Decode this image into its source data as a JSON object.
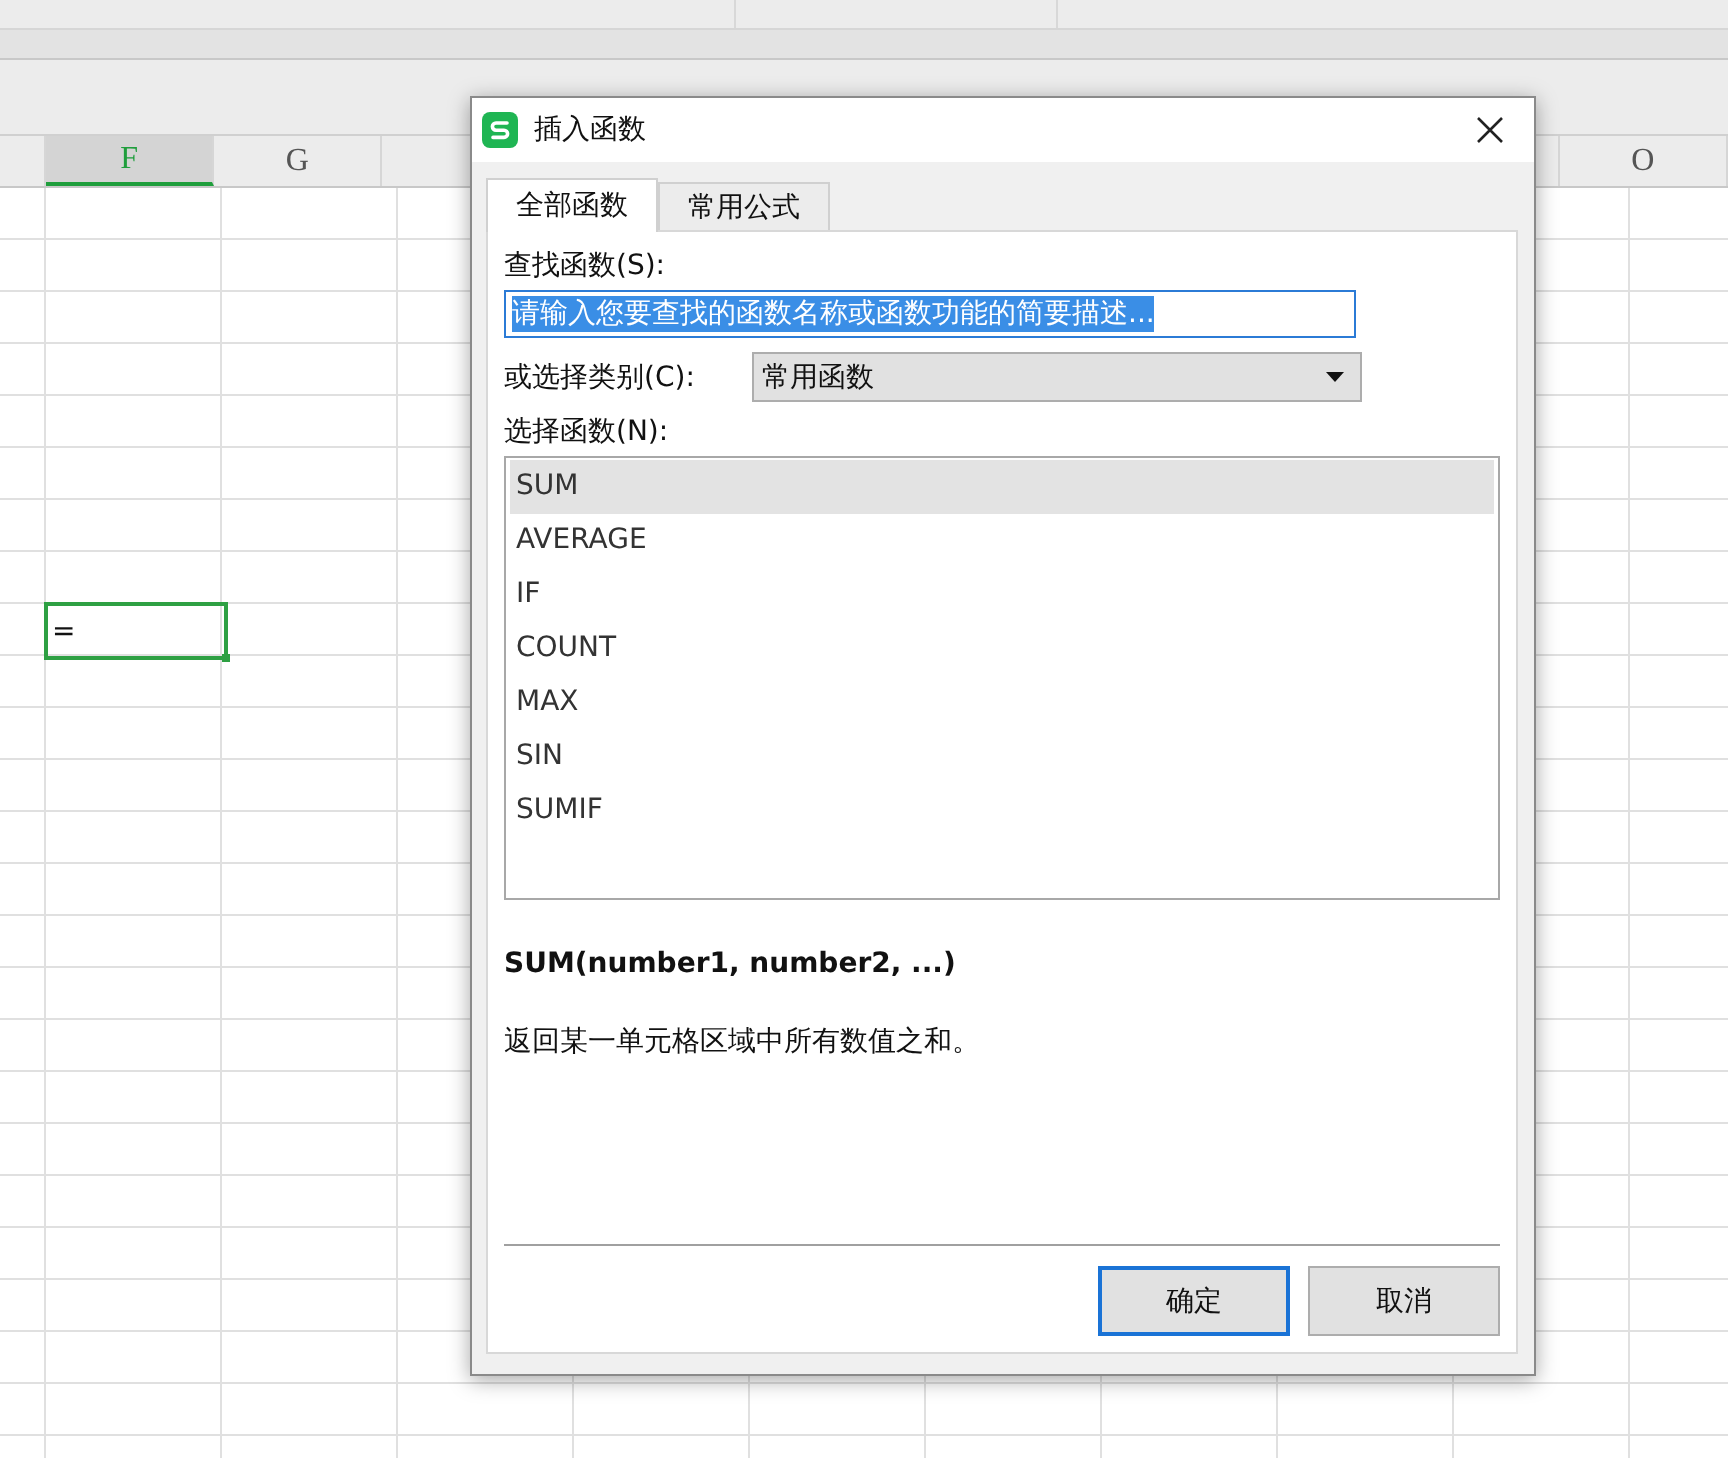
{
  "sheet": {
    "columns": [
      {
        "label": "F",
        "selected": true
      },
      {
        "label": "G",
        "selected": false
      },
      {
        "label": "O",
        "selected": false
      }
    ],
    "active_cell": {
      "value": "="
    }
  },
  "dialog": {
    "title": "插入函数",
    "tabs": [
      {
        "label": "全部函数",
        "selected": true
      },
      {
        "label": "常用公式",
        "selected": false
      }
    ],
    "search_label": "查找函数(S):",
    "search_value": "请输入您要查找的函数名称或函数功能的简要描述...",
    "search_value_selected": true,
    "category_label": "或选择类别(C):",
    "category_value": "常用函数",
    "functions_label": "选择函数(N):",
    "functions": [
      {
        "name": "SUM",
        "selected": true
      },
      {
        "name": "AVERAGE",
        "selected": false
      },
      {
        "name": "IF",
        "selected": false
      },
      {
        "name": "COUNT",
        "selected": false
      },
      {
        "name": "MAX",
        "selected": false
      },
      {
        "name": "SIN",
        "selected": false
      },
      {
        "name": "SUMIF",
        "selected": false
      }
    ],
    "signature": "SUM(number1, number2, ...)",
    "description": "返回某一单元格区域中所有数值之和。",
    "buttons": [
      {
        "label": "确定",
        "kind": "primary"
      },
      {
        "label": "取消",
        "kind": "secondary"
      }
    ]
  }
}
